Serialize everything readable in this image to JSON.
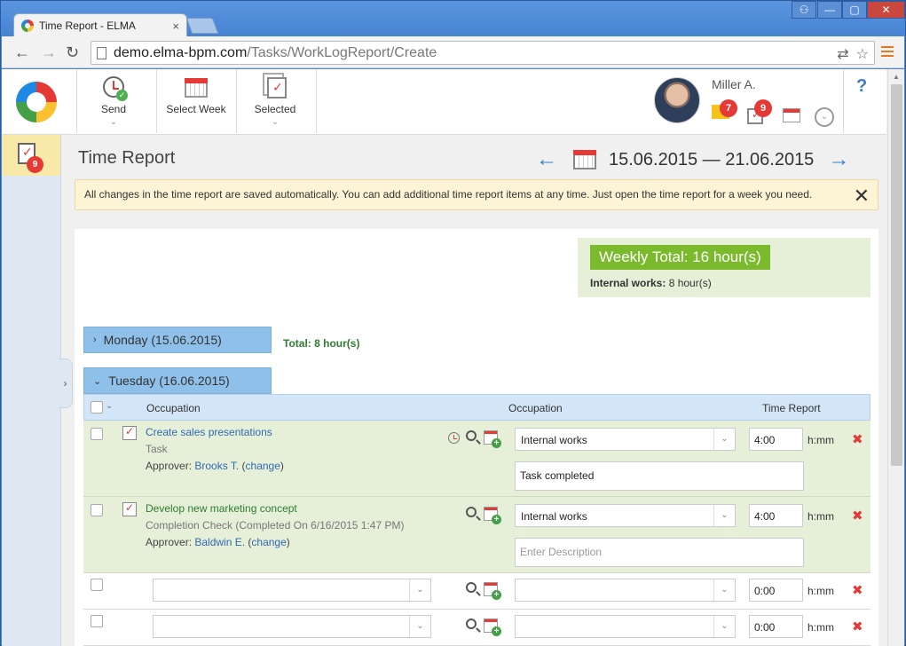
{
  "browser": {
    "tab_title": "Time Report - ELMA",
    "tab_close": "×",
    "url_host": "demo.elma-bpm.com",
    "url_path": "/Tasks/WorkLogReport/Create",
    "window_controls": {
      "user": "⚇",
      "minimize": "—",
      "maximize": "▢",
      "close": "✕"
    },
    "nav": {
      "back": "←",
      "forward": "→",
      "reload": "↻"
    },
    "omni_icons": {
      "translate": "⇄",
      "star": "☆"
    }
  },
  "header": {
    "buttons": [
      {
        "label": "Send",
        "chevron": "⌄"
      },
      {
        "label": "Select Week"
      },
      {
        "label": "Selected",
        "chevron": "⌄"
      }
    ],
    "user": {
      "name": "Miller A.",
      "mail_badge": "7",
      "tasks_badge": "9"
    },
    "expand_chevron": "⌄",
    "help": "?"
  },
  "sidebar": {
    "tasks_badge": "9",
    "toggle": "›"
  },
  "page": {
    "title": "Time Report",
    "prev_arrow": "←",
    "next_arrow": "→",
    "week_range": "15.06.2015 — 21.06.2015"
  },
  "notice": {
    "text": "All changes in the time report are saved automatically. You can add additional time report items at any time. Just open the time report for a week you need.",
    "close": "✕"
  },
  "summary": {
    "weekly_total": "Weekly Total: 16 hour(s)",
    "internal_label": "Internal works:",
    "internal_value": " 8 hour(s)"
  },
  "days": [
    {
      "label": "Monday (15.06.2015)",
      "chevron": "›",
      "total": "Total: 8 hour(s)"
    },
    {
      "label": "Tuesday (16.06.2015)",
      "chevron": "⌄"
    }
  ],
  "grid": {
    "headers": {
      "occupation_1": "Occupation",
      "occupation_2": "Occupation",
      "time_report": "Time Report"
    },
    "header_chevron": "⌄",
    "rows": [
      {
        "title": "Create sales presentations",
        "subtitle": "Task",
        "approver_label": "Approver: ",
        "approver": "Brooks T.",
        "change_open": " (",
        "change": "change",
        "change_close": ")",
        "occupation": "Internal works",
        "time": "4:00",
        "unit": "h:mm",
        "description": "Task completed"
      },
      {
        "title": "Develop new marketing concept",
        "subtitle": "Completion Check (Completed On 6/16/2015 1:47 PM)",
        "approver_label": "Approver: ",
        "approver": "Baldwin E.",
        "change_open": " (",
        "change": "change",
        "change_close": ")",
        "occupation": "Internal works",
        "time": "4:00",
        "unit": "h:mm",
        "description_placeholder": "Enter Description"
      },
      {
        "occupation": "",
        "time": "0:00",
        "unit": "h:mm"
      },
      {
        "occupation": "",
        "time": "0:00",
        "unit": "h:mm"
      }
    ],
    "delete": "✖",
    "dropdown": "⌄"
  }
}
